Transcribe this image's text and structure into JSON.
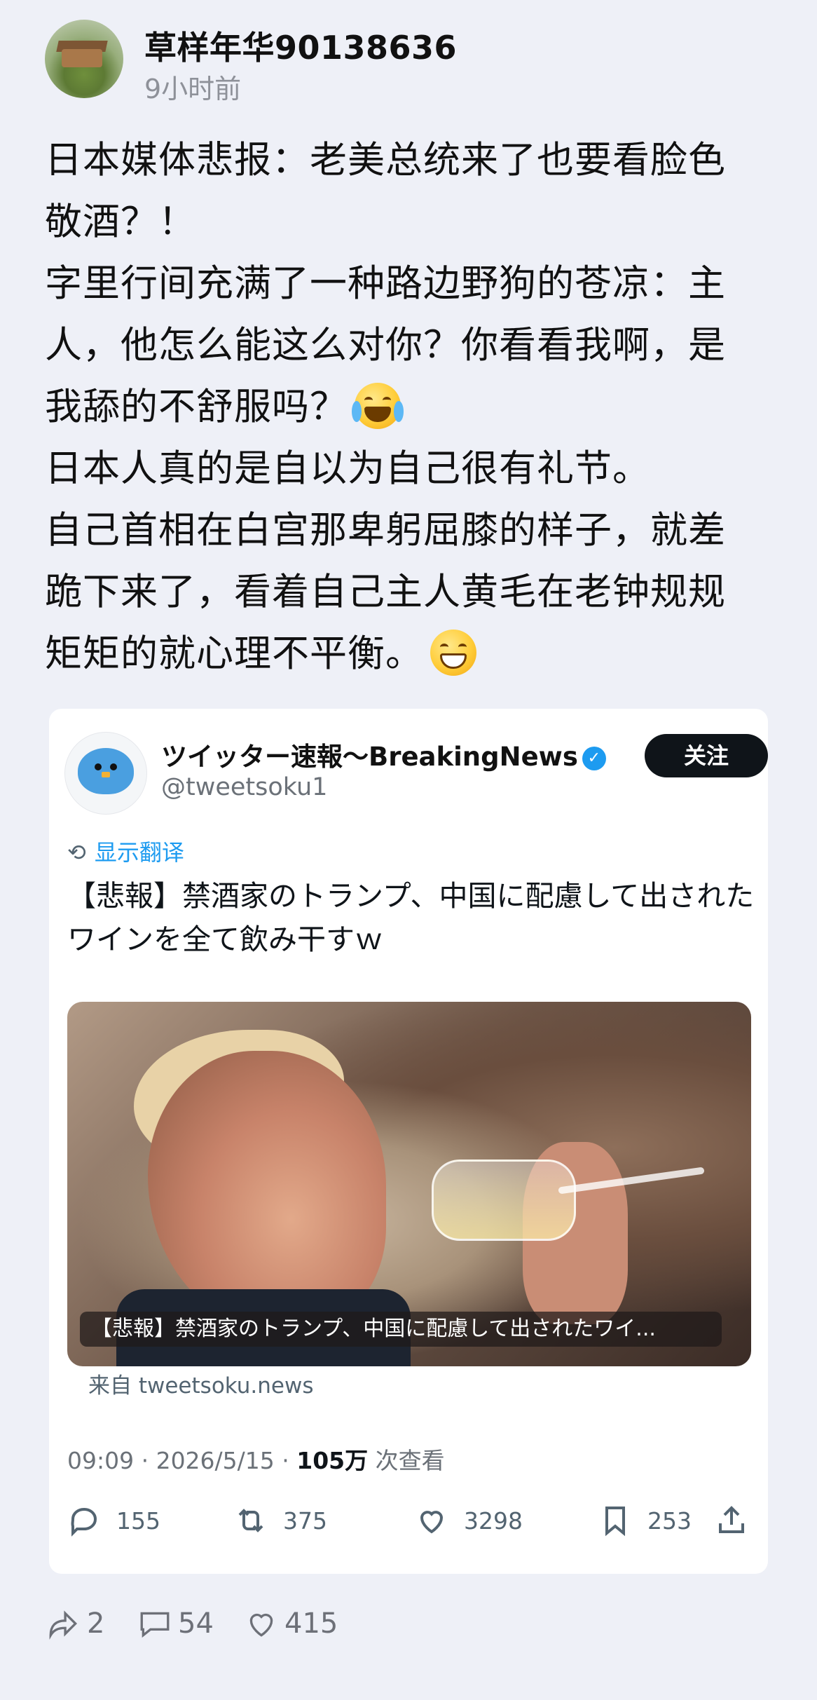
{
  "post": {
    "author": "草样年华90138636",
    "time": "9小时前",
    "lines": [
      "日本媒体悲报：老美总统来了也要看脸色",
      "敬酒？！",
      "字里行间充满了一种路边野狗的苍凉：主",
      "人，他怎么能这么对你？你看看我啊，是",
      "我舔的不舒服吗？",
      "日本人真的是自以为自己很有礼节。",
      "自己首相在白宫那卑躬屈膝的样子，就差",
      "跪下来了，看着自己主人黄毛在老钟规规",
      "矩矩的就心理不平衡。"
    ],
    "emojis": [
      "crying-laughing-emoji",
      "grinning-emoji"
    ]
  },
  "tweet": {
    "name": "ツイッター速報〜BreakingNews",
    "handle": "@tweetsoku1",
    "follow": "关注",
    "translate": "显示翻译",
    "text": "【悲報】禁酒家のトランプ、中国に配慮して出されたワインを全て飲み干すｗ",
    "media_caption": "【悲報】禁酒家のトランプ、中国に配慮して出されたワイ...",
    "source": "来自 tweetsoku.news",
    "time": "09:09 · 2026/5/15 · ",
    "views": "105万",
    "views_suffix": " 次查看",
    "replies": "155",
    "retweets": "375",
    "likes": "3298",
    "bookmarks": "253"
  },
  "footer": {
    "shares": "2",
    "comments": "54",
    "likes": "415"
  },
  "colors": {
    "background": "#eef0f7",
    "link": "#1d9bf0",
    "muted": "#8e9199"
  }
}
